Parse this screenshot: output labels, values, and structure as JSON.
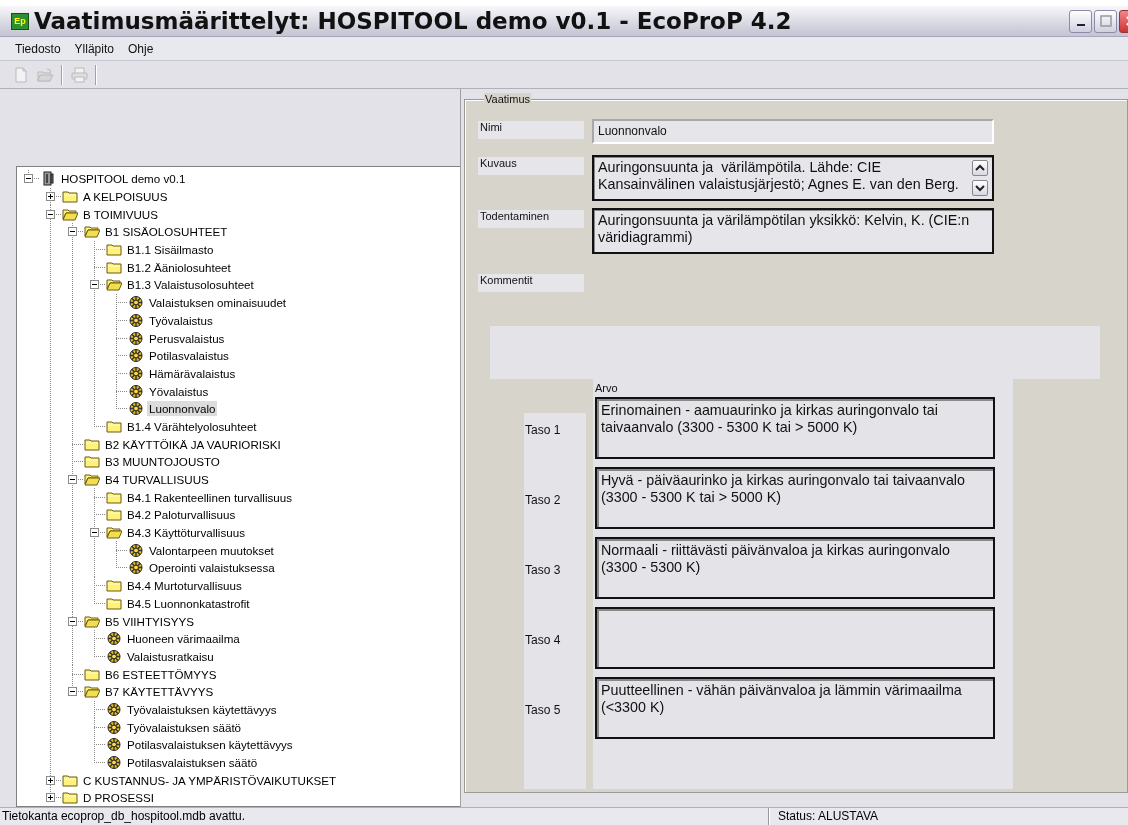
{
  "window": {
    "title": "Vaatimusmäärittelyt: HOSPITOOL demo v0.1 - EcoProP 4.2",
    "icon_label": "Ep"
  },
  "menu": [
    "Tiedosto",
    "Ylläpito",
    "Ohje"
  ],
  "toolbar": [
    {
      "kind": "new",
      "disabled": true
    },
    {
      "kind": "open",
      "disabled": true
    },
    {
      "kind": "separator"
    },
    {
      "kind": "print",
      "disabled": true
    },
    {
      "kind": "separator"
    }
  ],
  "tree": {
    "label": "HOSPITOOL demo v0.1",
    "kind": "root",
    "expanded": true,
    "selected": false,
    "children": [
      {
        "label": "A KELPOISUUS",
        "kind": "folder",
        "expanded": false,
        "selected": false
      },
      {
        "label": "B TOIMIVUUS",
        "kind": "folder",
        "expanded": true,
        "selected": false,
        "children": [
          {
            "label": "B1 SISÄOLOSUHTEET",
            "kind": "folder",
            "expanded": true,
            "selected": false,
            "children": [
              {
                "label": "B1.1 Sisäilmasto",
                "kind": "folder",
                "selected": false
              },
              {
                "label": "B1.2 Ääniolosuhteet",
                "kind": "folder",
                "selected": false
              },
              {
                "label": "B1.3 Valaistusolosuhteet",
                "kind": "folder",
                "expanded": true,
                "selected": false,
                "children": [
                  {
                    "label": "Valaistuksen ominaisuudet",
                    "kind": "leaf",
                    "selected": false
                  },
                  {
                    "label": "Työvalaistus",
                    "kind": "leaf",
                    "selected": false
                  },
                  {
                    "label": "Perusvalaistus",
                    "kind": "leaf",
                    "selected": false
                  },
                  {
                    "label": "Potilasvalaistus",
                    "kind": "leaf",
                    "selected": false
                  },
                  {
                    "label": "Hämärävalaistus",
                    "kind": "leaf",
                    "selected": false
                  },
                  {
                    "label": "Yövalaistus",
                    "kind": "leaf",
                    "selected": false
                  },
                  {
                    "label": "Luonnonvalo",
                    "kind": "leaf",
                    "selected": true
                  }
                ]
              },
              {
                "label": "B1.4 Värähtelyolosuhteet",
                "kind": "folder",
                "selected": false
              }
            ]
          },
          {
            "label": "B2 KÄYTTÖIKÄ JA VAURIORISKI",
            "kind": "folder",
            "selected": false
          },
          {
            "label": "B3 MUUNTOJOUSTO",
            "kind": "folder",
            "selected": false
          },
          {
            "label": "B4 TURVALLISUUS",
            "kind": "folder",
            "expanded": true,
            "selected": false,
            "children": [
              {
                "label": "B4.1 Rakenteellinen turvallisuus",
                "kind": "folder",
                "selected": false
              },
              {
                "label": "B4.2 Paloturvallisuus",
                "kind": "folder",
                "selected": false
              },
              {
                "label": "B4.3 Käyttöturvallisuus",
                "kind": "folder",
                "expanded": true,
                "selected": false,
                "children": [
                  {
                    "label": "Valontarpeen muutokset",
                    "kind": "leaf",
                    "selected": false
                  },
                  {
                    "label": "Operointi valaistuksessa",
                    "kind": "leaf",
                    "selected": false
                  }
                ]
              },
              {
                "label": "B4.4 Murtoturvallisuus",
                "kind": "folder",
                "selected": false
              },
              {
                "label": "B4.5 Luonnonkatastrofit",
                "kind": "folder",
                "selected": false
              }
            ]
          },
          {
            "label": "B5 VIIHTYISYYS",
            "kind": "folder",
            "expanded": true,
            "selected": false,
            "children": [
              {
                "label": "Huoneen värimaailma",
                "kind": "leaf",
                "selected": false
              },
              {
                "label": "Valaistusratkaisu",
                "kind": "leaf",
                "selected": false
              }
            ]
          },
          {
            "label": "B6 ESTEETTÖMYYS",
            "kind": "folder",
            "selected": false
          },
          {
            "label": "B7 KÄYTETTÄVYYS",
            "kind": "folder",
            "expanded": true,
            "selected": false,
            "children": [
              {
                "label": "Työvalaistuksen käytettävyys",
                "kind": "leaf",
                "selected": false
              },
              {
                "label": "Työvalaistuksen säätö",
                "kind": "leaf",
                "selected": false
              },
              {
                "label": "Potilasvalaistuksen käytettävyys",
                "kind": "leaf",
                "selected": false
              },
              {
                "label": "Potilasvalaistuksen säätö",
                "kind": "leaf",
                "selected": false
              }
            ]
          }
        ]
      },
      {
        "label": "C KUSTANNUS- JA YMPÄRISTÖVAIKUTUKSET",
        "kind": "folder",
        "expanded": false,
        "selected": false
      },
      {
        "label": "D PROSESSI",
        "kind": "folder",
        "expanded": false,
        "selected": false
      }
    ]
  },
  "form": {
    "group_title": "Vaatimus",
    "fields": [
      {
        "label": "Nimi",
        "kind": "single",
        "value": "Luonnonvalo"
      },
      {
        "label": "Kuvaus",
        "kind": "scrolling",
        "value": "Auringonsuunta ja  värilämpötila. Lähde: CIE\nKansainvälinen valaistusjärjestö; Agnes E. van den Berg."
      },
      {
        "label": "Todentaminen",
        "kind": "multi",
        "value": "Auringonsuunta ja värilämpötilan yksikkö: Kelvin, K. (CIE:n väridiagrammi)"
      },
      {
        "label": "Kommentit",
        "kind": "label_only"
      }
    ],
    "levels_title": "Arvo",
    "levels": [
      {
        "label": "Taso 1",
        "value": "Erinomainen - aamuaurinko ja kirkas auringonvalo tai taivaanvalo (3300 - 5300 K tai > 5000 K)"
      },
      {
        "label": "Taso 2",
        "value": "Hyvä - päiväaurinko ja kirkas auringonvalo tai taivaanvalo (3300 - 5300 K tai > 5000 K)"
      },
      {
        "label": "Taso 3",
        "value": "Normaali - riittävästi päivänvaloa ja kirkas auringonvalo (3300 - 5300 K)"
      },
      {
        "label": "Taso 4"
      },
      {
        "label": "Taso 5",
        "value": "Puutteellinen - vähän päivänvaloa ja lämmin värimaailma (<3300 K)"
      }
    ]
  },
  "status_bar": {
    "message": "Tietokanta ecoprop_db_hospitool.mdb avattu.",
    "status": "Status: ALUSTAVA"
  }
}
